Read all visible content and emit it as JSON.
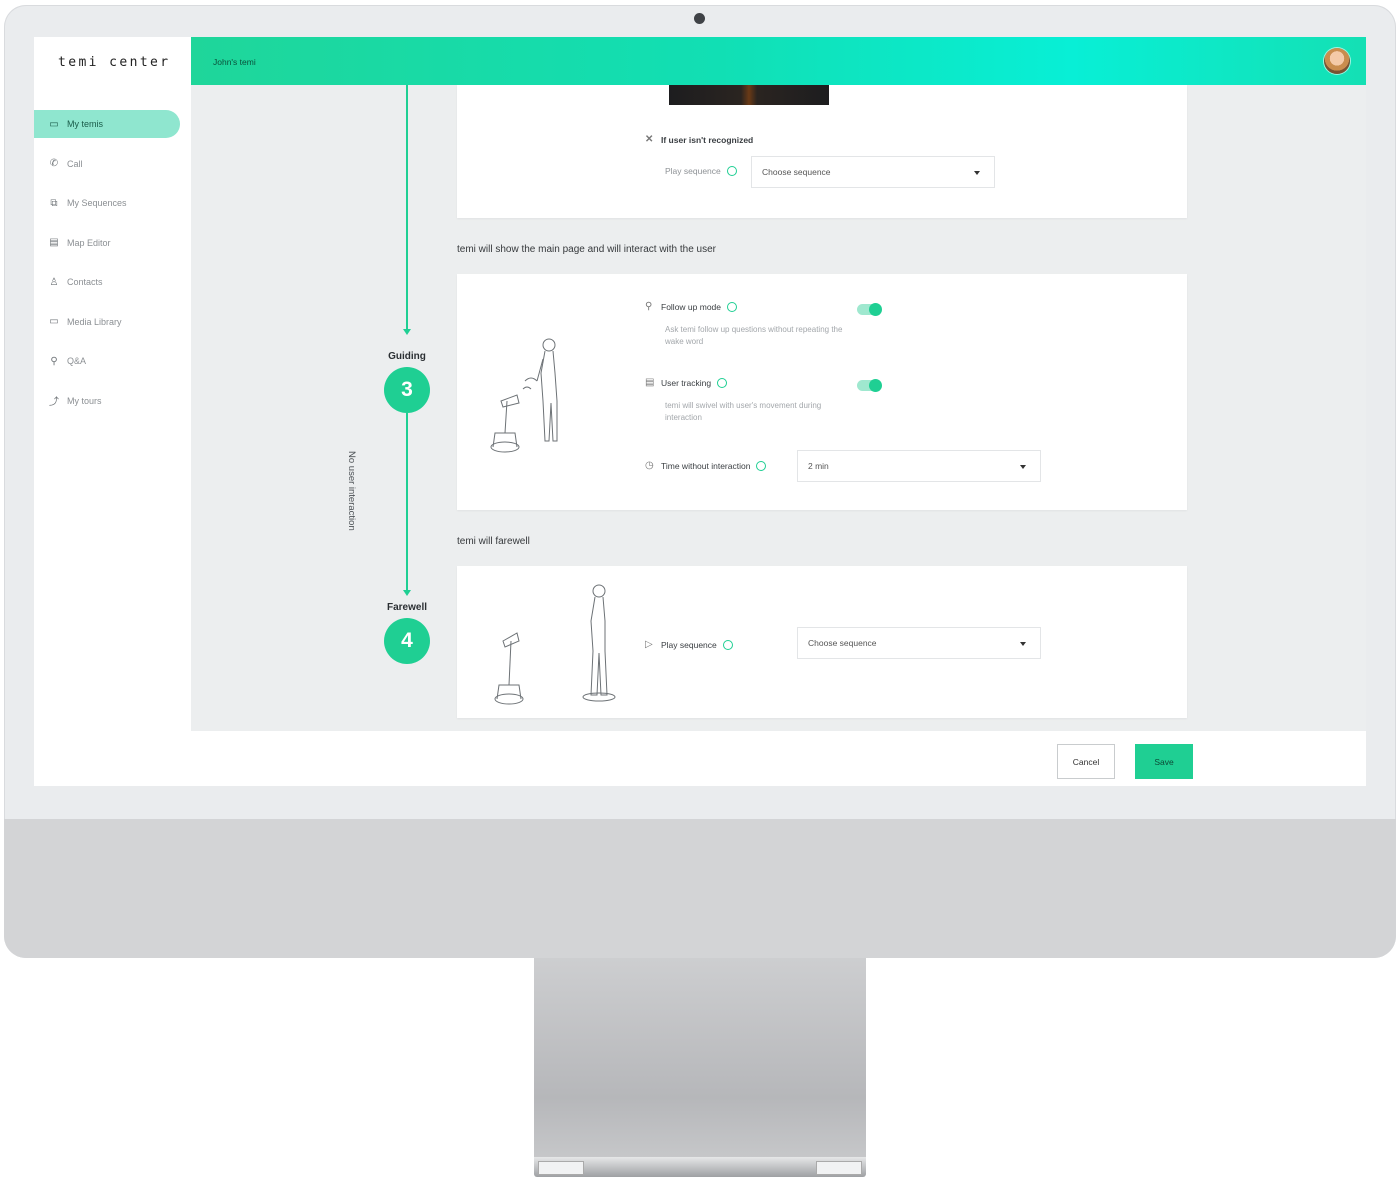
{
  "app": {
    "logo": "temi center",
    "topbar_title": "John's temi"
  },
  "sidebar": {
    "items": [
      {
        "label": "My temis",
        "icon": "▭",
        "active": true
      },
      {
        "label": "Call",
        "icon": "✆"
      },
      {
        "label": "My Sequences",
        "icon": "⧉"
      },
      {
        "label": "Map Editor",
        "icon": "▤"
      },
      {
        "label": "Contacts",
        "icon": "♙"
      },
      {
        "label": "Media Library",
        "icon": "▭"
      },
      {
        "label": "Q&A",
        "icon": "⚲"
      },
      {
        "label": "My tours",
        "icon": "⤴"
      }
    ]
  },
  "timeline": {
    "steps": [
      {
        "number": "3",
        "label": "Guiding"
      },
      {
        "number": "4",
        "label": "Farewell"
      }
    ],
    "connector_label": "No user interaction"
  },
  "recognition_card": {
    "heading": "If user isn't recognized",
    "play_label": "Play sequence",
    "select_value": "Choose sequence"
  },
  "interaction_section": {
    "title": "temi will show the main page and will interact with the user",
    "follow_up": {
      "label": "Follow up mode",
      "description": "Ask temi follow up questions without repeating the wake word"
    },
    "user_tracking": {
      "label": "User tracking",
      "description": "temi will swivel with user's movement during interaction"
    },
    "time_without_interaction": {
      "label": "Time without interaction",
      "value": "2 min"
    }
  },
  "farewell_section": {
    "title": "temi will farewell",
    "play_label": "Play sequence",
    "select_value": "Choose sequence"
  },
  "footer": {
    "cancel": "Cancel",
    "save": "Save"
  },
  "colors": {
    "accent": "#1fcf93",
    "topbar_start": "#1fd69a",
    "topbar_end": "#08efd6"
  }
}
